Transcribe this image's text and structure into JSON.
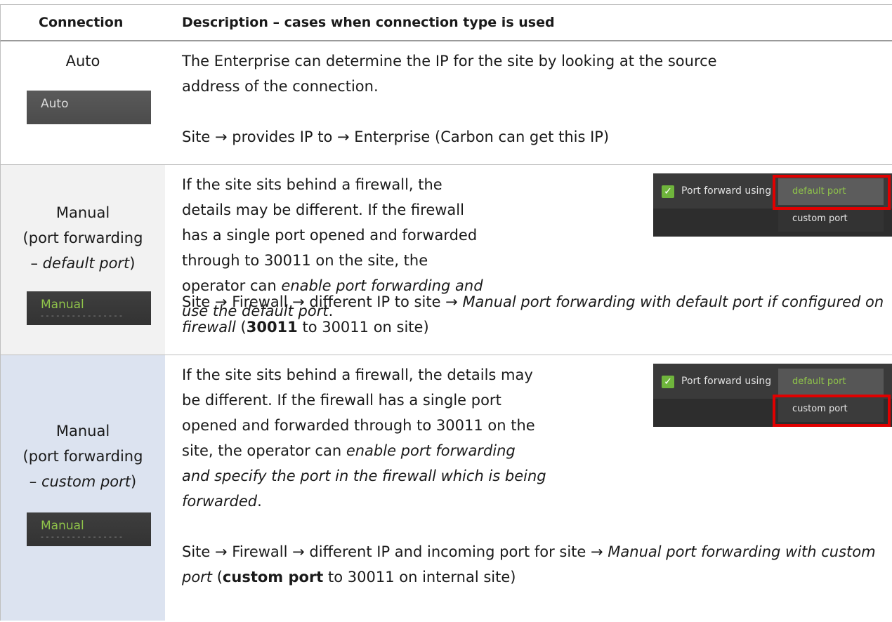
{
  "table": {
    "header": {
      "col1": "Connection",
      "col2": "Description – cases when connection type is used"
    },
    "rows": [
      {
        "name": "Auto",
        "button_label": "Auto",
        "para1": "The Enterprise can determine the IP for the site by looking at the source address of the connection.",
        "flow": "Site → provides IP to → Enterprise (Carbon can get this IP)"
      },
      {
        "name_line1": "Manual",
        "name_line2": "(port forwarding",
        "name_line3_prefix": "– ",
        "name_line3_em": "default port",
        "name_line3_suffix": ")",
        "button_label": "Manual",
        "para1_text": "If the site sits behind a firewall, the details may be different. If the firewall has a single port opened and forwarded through to 30011 on the site, the operator can ",
        "para1_em": "enable port forwarding and use the default port",
        "para1_end": ".",
        "flow_text": "Site → Firewall → different IP to site → ",
        "flow_em": "Manual port forwarding with default port if configured on firewall",
        "flow_paren_open": " (",
        "flow_bold": "30011",
        "flow_tail": " to 30011 on site)",
        "screenshot": {
          "checkbox_label": "Port forward using",
          "option_default": "default port",
          "option_custom": "custom port",
          "highlighted": "default port"
        }
      },
      {
        "name_line1": "Manual",
        "name_line2": "(port forwarding",
        "name_line3_prefix": "– ",
        "name_line3_em": "custom port",
        "name_line3_suffix": ")",
        "button_label": "Manual",
        "para1_text": "If the site sits behind a firewall, the details may be different. If the firewall has a single port opened and forwarded through to 30011 on the site, the operator can ",
        "para1_em": "enable port forwarding and specify the port in the firewall which is being forwarded",
        "para1_end": ".",
        "flow_text": "Site → Firewall → different IP and incoming port for site → ",
        "flow_em": "Manual port forwarding with custom port",
        "flow_paren_open": " (",
        "flow_bold": "custom port",
        "flow_tail": " to 30011 on internal site)",
        "screenshot": {
          "checkbox_label": "Port forward using",
          "option_default": "default port",
          "option_custom": "custom port",
          "highlighted": "custom port"
        }
      }
    ]
  },
  "colors": {
    "highlight": "#e00000",
    "green_text": "#8fc34a",
    "row2_bg": "#f2f2f2",
    "row3_bg": "#dce3f0"
  },
  "icons": [
    "checkmark-icon",
    "right-arrow-icon"
  ]
}
